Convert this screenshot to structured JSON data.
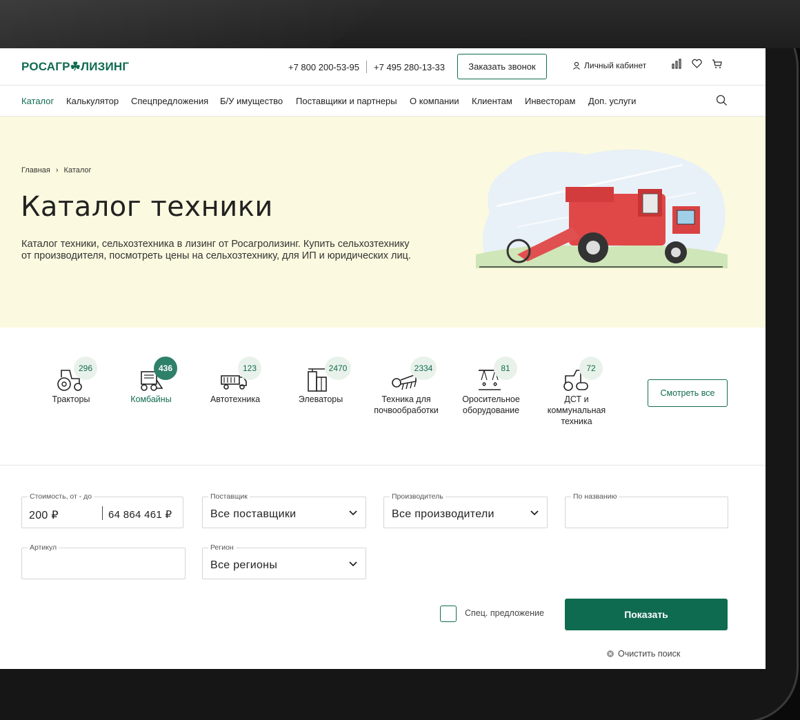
{
  "header": {
    "logo": "РОСАГР☘ЛИЗИНГ",
    "phone1": "+7 800 200-53-95",
    "phone2": "+7 495 280-13-33",
    "callback_label": "Заказать звонок",
    "cabinet_label": "Личный кабинет",
    "icons": [
      "compare-icon",
      "heart-icon",
      "cart-icon"
    ]
  },
  "nav": {
    "items": [
      "Каталог",
      "Калькулятор",
      "Спецпредложения",
      "Б/У имущество",
      "Поставщики и партнеры",
      "О компании",
      "Клиентам",
      "Инвесторам",
      "Доп. услуги"
    ],
    "active": "Каталог"
  },
  "hero": {
    "crumb_home": "Главная",
    "crumb_sep": "›",
    "crumb_current": "Каталог",
    "title": "Каталог техники",
    "description": "Каталог техники, сельхозтехника в лизинг от Росагролизинг. Купить сельхозтехнику от производителя, посмотреть цены на сельхозтехнику, для ИП и юридических лиц."
  },
  "categories": {
    "items": [
      {
        "label": "Тракторы",
        "count": "296",
        "icon": "tractor-icon",
        "active": false
      },
      {
        "label": "Комбайны",
        "count": "436",
        "icon": "combine-icon",
        "active": true
      },
      {
        "label": "Автотехника",
        "count": "123",
        "icon": "truck-icon",
        "active": false
      },
      {
        "label": "Элеваторы",
        "count": "2470",
        "icon": "elevator-icon",
        "active": false
      },
      {
        "label": "Техника для почвообработки",
        "count": "2334",
        "icon": "cultivator-icon",
        "active": false
      },
      {
        "label": "Оросительное оборудование",
        "count": "81",
        "icon": "irrigation-icon",
        "active": false
      },
      {
        "label": "ДСТ и коммунальная техника",
        "count": "72",
        "icon": "roller-icon",
        "active": false
      }
    ],
    "view_all_label": "Смотреть все"
  },
  "filters": {
    "price_caption": "Стоимость, от - до",
    "price_from": "200 ₽",
    "price_to": "64 864 461 ₽",
    "supplier_caption": "Поставщик",
    "supplier_value": "Все поставщики",
    "manufacturer_caption": "Производитель",
    "manufacturer_value": "Все производители",
    "name_caption": "По названию",
    "name_value": "",
    "article_caption": "Артикул",
    "article_value": "",
    "region_caption": "Регион",
    "region_value": "Все регионы",
    "special_label": "Спец. предложение",
    "special_checked": false,
    "show_label": "Показать",
    "clear_label": "Очистить поиск"
  },
  "colors": {
    "brand_green": "#0f6b50",
    "hero_bg": "#fbf9df",
    "badge_bg": "#e9f2ea"
  }
}
